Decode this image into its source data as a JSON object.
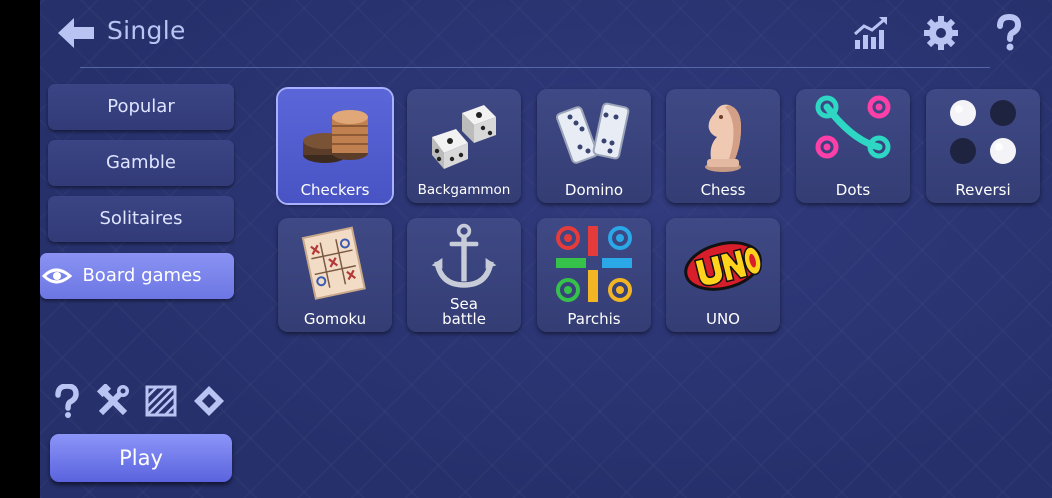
{
  "header": {
    "title": "Single",
    "icons": [
      "back-arrow-icon",
      "stats-chart-icon",
      "gear-icon",
      "question-icon"
    ]
  },
  "categories": [
    {
      "label": "Popular",
      "active": false
    },
    {
      "label": "Gamble",
      "active": false
    },
    {
      "label": "Solitaires",
      "active": false
    },
    {
      "label": "Board games",
      "active": true
    }
  ],
  "games": [
    {
      "label": "Checkers",
      "icon": "checkers-icon",
      "selected": true
    },
    {
      "label": "Backgammon",
      "icon": "dice-icon",
      "selected": false
    },
    {
      "label": "Domino",
      "icon": "domino-icon",
      "selected": false
    },
    {
      "label": "Chess",
      "icon": "chess-knight-icon",
      "selected": false
    },
    {
      "label": "Dots",
      "icon": "dots-icon",
      "selected": false
    },
    {
      "label": "Reversi",
      "icon": "reversi-icon",
      "selected": false
    },
    {
      "label": "Gomoku",
      "icon": "gomoku-paper-icon",
      "selected": false
    },
    {
      "label": "Sea\nbattle",
      "icon": "anchor-icon",
      "selected": false
    },
    {
      "label": "Parchis",
      "icon": "parchis-board-icon",
      "selected": false
    },
    {
      "label": "UNO",
      "icon": "uno-logo-icon",
      "selected": false
    }
  ],
  "footer": {
    "icons": [
      "question-icon",
      "tools-icon",
      "pattern-icon",
      "diamond-icon"
    ],
    "play_label": "Play"
  },
  "colors": {
    "background": "#26306b",
    "accent": "#7780ee",
    "tile": "#3a4480",
    "header_text": "#b9c4f3"
  }
}
